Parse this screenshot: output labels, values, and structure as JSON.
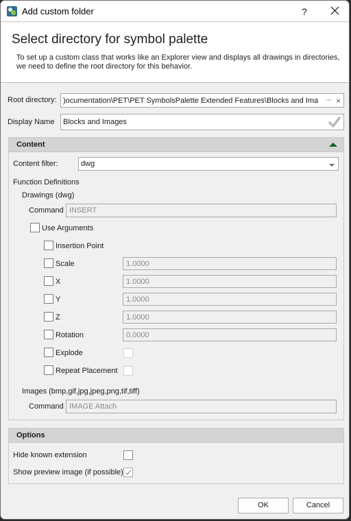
{
  "window": {
    "title": "Add custom folder",
    "help_label": "?",
    "icon": "app-gear-icon",
    "close_icon": "close-icon"
  },
  "header": {
    "title": "Select directory for symbol palette",
    "description": "To set up a custom class that works like an Explorer view and displays all drawings in directories, we need to define the root directory for this behavior."
  },
  "root_directory": {
    "label": "Root directory:",
    "value": ")ocumentation\\PET\\PET SymbolsPalette Extended Features\\Blocks and Images",
    "browse_label": "···",
    "clear_label": "×"
  },
  "display_name": {
    "label": "Display Name",
    "value": "Blocks and Images",
    "valid_icon": "checkmark-icon"
  },
  "content": {
    "title": "Content",
    "collapse_icon": "triangle-up-icon",
    "filter_label": "Content filter:",
    "filter_value": "dwg",
    "function_definitions_label": "Function Definitions",
    "drawings_label": "Drawings (dwg)",
    "command_label": "Command",
    "command_value": "INSERT",
    "use_arguments": {
      "label": "Use Arguments",
      "checked": false
    },
    "arguments": [
      {
        "label": "Insertion Point",
        "checked": false
      },
      {
        "label": "Scale",
        "checked": false,
        "value": "1.0000"
      },
      {
        "label": "X",
        "checked": false,
        "value": "1.0000"
      },
      {
        "label": "Y",
        "checked": false,
        "value": "1.0000"
      },
      {
        "label": "Z",
        "checked": false,
        "value": "1.0000"
      },
      {
        "label": "Rotation",
        "checked": false,
        "value": "0.0000"
      },
      {
        "label": "Explode",
        "checked": false,
        "value_checked": false
      },
      {
        "label": "Repeat Placement",
        "checked": false,
        "value_checked": false
      }
    ],
    "images_label": "Images (bmp,gif,jpg,jpeg,png,tif,tiff)",
    "images_command_label": "Command",
    "images_command_value": "IMAGE Attach"
  },
  "options": {
    "title": "Options",
    "hide_known_extension": {
      "label": "Hide known extension",
      "checked": false
    },
    "show_preview_image": {
      "label": "Show preview image (if possible)",
      "checked": true
    }
  },
  "buttons": {
    "ok": "OK",
    "cancel": "Cancel"
  }
}
